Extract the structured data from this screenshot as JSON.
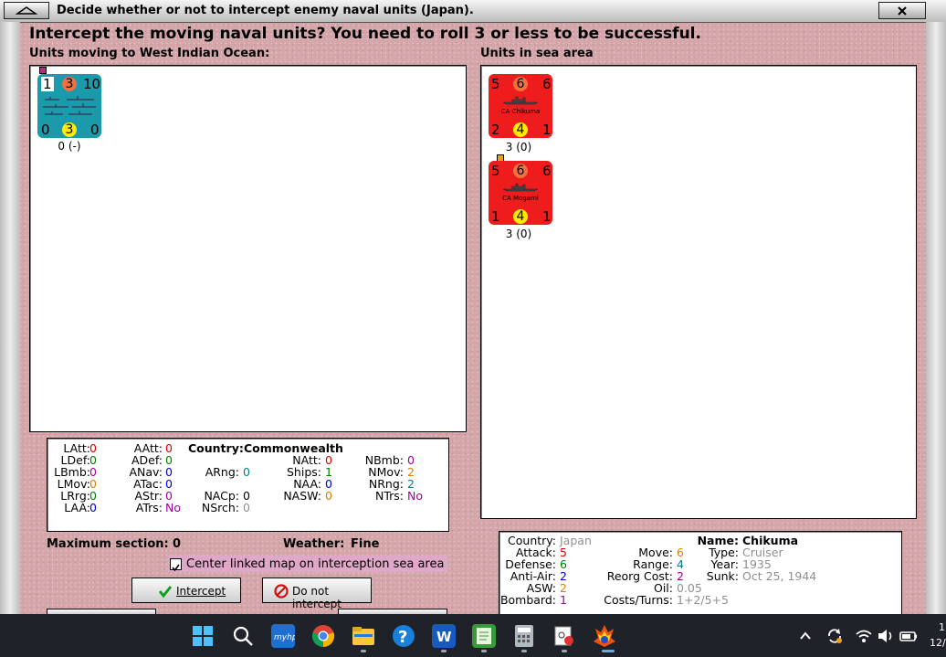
{
  "window": {
    "title": "Decide whether or not to intercept enemy naval units (Japan).",
    "heading": "Intercept the moving naval units?  You need to roll 3 or less to be successful."
  },
  "left_panel": {
    "label": "Units moving to West Indian Ocean:",
    "unit": {
      "top_left": "1",
      "top_center": "3",
      "top_right": "10",
      "bottom_left": "0",
      "bottom_center": "3",
      "bottom_right": "0",
      "caption": "0 (-)",
      "color": "#1a9aaa"
    }
  },
  "right_panel": {
    "label": "Units in sea area",
    "units": [
      {
        "top_left": "5",
        "top_center": "6",
        "top_right": "6",
        "name": "CA Chikuma",
        "bottom_left": "2",
        "bottom_center": "4",
        "bottom_right": "1",
        "caption": "3 (0)"
      },
      {
        "top_left": "5",
        "top_center": "6",
        "top_right": "6",
        "name": "CA Mogami",
        "bottom_left": "1",
        "bottom_center": "4",
        "bottom_right": "1",
        "caption": "3 (0)"
      }
    ],
    "color": "#ee1c1c"
  },
  "left_stats": {
    "country_label": "Country:",
    "country": "Commonwealth",
    "col1": [
      [
        "LAtt:",
        "0"
      ],
      [
        "LDef:",
        "0"
      ],
      [
        "LBmb:",
        "0"
      ],
      [
        "LMov:",
        "0"
      ],
      [
        "LRrg:",
        "0"
      ],
      [
        "LAA:",
        "0"
      ]
    ],
    "col2": [
      [
        "AAtt:",
        "0"
      ],
      [
        "ADef:",
        "0"
      ],
      [
        "ANav:",
        "0"
      ],
      [
        "ATac:",
        "0"
      ],
      [
        "AStr:",
        "0"
      ],
      [
        "ATrs:",
        "No"
      ]
    ],
    "col3": [
      [
        "ARng:",
        "0"
      ],
      [
        "NACp:",
        "0"
      ],
      [
        "NSrch:",
        "0"
      ]
    ],
    "col4": [
      [
        "NAtt:",
        "0"
      ],
      [
        "Ships:",
        "1"
      ],
      [
        "NAA:",
        "0"
      ],
      [
        "NASW:",
        "0"
      ]
    ],
    "col5": [
      [
        "NBmb:",
        "0"
      ],
      [
        "NMov:",
        "2"
      ],
      [
        "NRng:",
        "2"
      ],
      [
        "NTrs:",
        "No"
      ]
    ]
  },
  "status": {
    "max_section_label": "Maximum section:",
    "max_section": "0",
    "weather_label": "Weather:",
    "weather": "Fine",
    "center_checkbox_label": "Center linked map on interception sea area"
  },
  "buttons": {
    "intercept": "Intercept",
    "do_not_intercept": "Do not intercept"
  },
  "unit_details": {
    "country_label": "Country:",
    "country": "Japan",
    "attack_label": "Attack:",
    "attack": "5",
    "defense_label": "Defense:",
    "defense": "6",
    "antiair_label": "Anti-Air:",
    "antiair": "2",
    "asw_label": "ASW:",
    "asw": "2",
    "bombard_label": "Bombard:",
    "bombard": "1",
    "move_label": "Move:",
    "move": "6",
    "range_label": "Range:",
    "range": "4",
    "reorg_label": "Reorg Cost:",
    "reorg": "2",
    "oil_label": "Oil:",
    "oil": "0.05",
    "costs_label": "Costs/Turns:",
    "costs": "1+2/5+5",
    "name_label": "Name:",
    "name": "Chikuma",
    "type_label": "Type:",
    "type": "Cruiser",
    "year_label": "Year:",
    "year": "1935",
    "sunk_label": "Sunk:",
    "sunk": "Oct 25, 1944"
  },
  "taskbar": {
    "clock_partial_1": "1",
    "clock_partial_2": "12/"
  }
}
